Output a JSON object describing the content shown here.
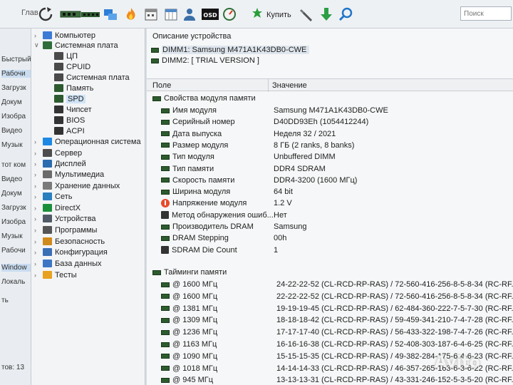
{
  "toolbar": {
    "partial_left_label": "Глав",
    "buy_label": "Купить",
    "search_placeholder": "Поиск",
    "icons": [
      "refresh-icon",
      "memory-module-icon",
      "ram-stick-icon",
      "network-icon",
      "flame-icon",
      "calendar-icon",
      "user-icon",
      "osd-icon",
      "gauge-icon",
      "buy-icon",
      "tools-icon",
      "download-arrow-icon",
      "search-icon"
    ],
    "osd_text": "OSD"
  },
  "background_window": {
    "items": [
      {
        "label": "Быстрый"
      },
      {
        "label": "Рабочи",
        "selected": true
      },
      {
        "label": "Загрузк"
      },
      {
        "label": "Докум"
      },
      {
        "label": "Изобра"
      },
      {
        "label": "Видео"
      },
      {
        "label": "Музык"
      },
      {
        "label": "тот ком"
      },
      {
        "label": "Видео"
      },
      {
        "label": "Докум"
      },
      {
        "label": "Загрузк"
      },
      {
        "label": "Изобра"
      },
      {
        "label": "Музык"
      },
      {
        "label": "Рабочи"
      },
      {
        "label": "Window",
        "selected": true
      },
      {
        "label": "Локаль"
      },
      {
        "label": "ть"
      },
      {
        "label": "тов: 13"
      }
    ]
  },
  "tree": {
    "items": [
      {
        "label": "Компьютер",
        "icon": "computer-icon",
        "color": "#3b7bd6",
        "expandable": true,
        "depth": 0
      },
      {
        "label": "Системная плата",
        "icon": "motherboard-icon",
        "color": "#2f6e3a",
        "expanded": true,
        "depth": 0
      },
      {
        "label": "ЦП",
        "icon": "cpu-icon",
        "color": "#4a4a4a",
        "depth": 1
      },
      {
        "label": "CPUID",
        "icon": "cpuid-icon",
        "color": "#4a4a4a",
        "depth": 1
      },
      {
        "label": "Системная плата",
        "icon": "board-icon",
        "color": "#4a4a4a",
        "depth": 1
      },
      {
        "label": "Память",
        "icon": "memory-icon",
        "color": "#2d5b2f",
        "depth": 1
      },
      {
        "label": "SPD",
        "icon": "spd-icon",
        "color": "#2d5b2f",
        "depth": 1,
        "selected": true
      },
      {
        "label": "Чипсет",
        "icon": "chipset-icon",
        "color": "#333333",
        "depth": 1
      },
      {
        "label": "BIOS",
        "icon": "bios-icon",
        "color": "#333333",
        "depth": 1
      },
      {
        "label": "ACPI",
        "icon": "acpi-icon",
        "color": "#333333",
        "depth": 1
      },
      {
        "label": "Операционная система",
        "icon": "windows-icon",
        "color": "#1e88e5",
        "expandable": true,
        "depth": 0
      },
      {
        "label": "Сервер",
        "icon": "server-icon",
        "color": "#4d4d4d",
        "expandable": true,
        "depth": 0
      },
      {
        "label": "Дисплей",
        "icon": "display-icon",
        "color": "#2b6cb0",
        "expandable": true,
        "depth": 0
      },
      {
        "label": "Мультимедиа",
        "icon": "multimedia-icon",
        "color": "#6b6b6b",
        "expandable": true,
        "depth": 0
      },
      {
        "label": "Хранение данных",
        "icon": "storage-icon",
        "color": "#7a7a7a",
        "expandable": true,
        "depth": 0
      },
      {
        "label": "Сеть",
        "icon": "network-icon",
        "color": "#2a7fbf",
        "expandable": true,
        "depth": 0
      },
      {
        "label": "DirectX",
        "icon": "directx-icon",
        "color": "#1a8f3a",
        "expandable": true,
        "depth": 0
      },
      {
        "label": "Устройства",
        "icon": "devices-icon",
        "color": "#4f5a66",
        "expandable": true,
        "depth": 0
      },
      {
        "label": "Программы",
        "icon": "programs-icon",
        "color": "#555555",
        "expandable": true,
        "depth": 0
      },
      {
        "label": "Безопасность",
        "icon": "security-icon",
        "color": "#d08a1c",
        "expandable": true,
        "depth": 0
      },
      {
        "label": "Конфигурация",
        "icon": "configuration-icon",
        "color": "#3a6fb5",
        "expandable": true,
        "depth": 0
      },
      {
        "label": "База данных",
        "icon": "database-icon",
        "color": "#3d77c4",
        "expandable": true,
        "depth": 0
      },
      {
        "label": "Тесты",
        "icon": "tests-icon",
        "color": "#e8a21f",
        "expandable": true,
        "depth": 0
      }
    ]
  },
  "panel": {
    "description_title": "Описание устройства",
    "devices": [
      {
        "label": "DIMM1: Samsung M471A1K43DB0-CWE",
        "selected": true
      },
      {
        "label": "DIMM2: [ TRIAL VERSION ]"
      }
    ],
    "columns": {
      "field": "Поле",
      "value": "Значение"
    },
    "properties_group": "Свойства модуля памяти",
    "properties": [
      {
        "field": "Имя модуля",
        "value": "Samsung M471A1K43DB0-CWE",
        "icon": "ram-icon"
      },
      {
        "field": "Серийный номер",
        "value": "D40DD93Eh (1054412244)",
        "icon": "ram-icon"
      },
      {
        "field": "Дата выпуска",
        "value": "Неделя 32 / 2021",
        "icon": "ram-icon"
      },
      {
        "field": "Размер модуля",
        "value": "8 ГБ (2 ranks, 8 banks)",
        "icon": "ram-icon"
      },
      {
        "field": "Тип модуля",
        "value": "Unbuffered DIMM",
        "icon": "ram-icon"
      },
      {
        "field": "Тип памяти",
        "value": "DDR4 SDRAM",
        "icon": "ram-icon"
      },
      {
        "field": "Скорость памяти",
        "value": "DDR4-3200 (1600 МГц)",
        "icon": "ram-icon"
      },
      {
        "field": "Ширина модуля",
        "value": "64 bit",
        "icon": "ram-icon"
      },
      {
        "field": "Напряжение модуля",
        "value": "1.2 V",
        "icon": "voltage-icon"
      },
      {
        "field": "Метод обнаружения ошиб...",
        "value": "Нет",
        "icon": "chip-icon"
      },
      {
        "field": "Производитель DRAM",
        "value": "Samsung",
        "icon": "ram-icon"
      },
      {
        "field": "DRAM Stepping",
        "value": "00h",
        "icon": "ram-icon"
      },
      {
        "field": "SDRAM Die Count",
        "value": "1",
        "icon": "chip-icon"
      }
    ],
    "timings_group": "Тайминги памяти",
    "timings": [
      {
        "field": "@ 1600 МГц",
        "value": "24-22-22-52  (CL-RCD-RP-RAS) / 72-560-416-256-8-5-8-34  (RC-RF..."
      },
      {
        "field": "@ 1600 МГц",
        "value": "22-22-22-52  (CL-RCD-RP-RAS) / 72-560-416-256-8-5-8-34  (RC-RF..."
      },
      {
        "field": "@ 1381 МГц",
        "value": "19-19-19-45  (CL-RCD-RP-RAS) / 62-484-360-222-7-5-7-30  (RC-RF..."
      },
      {
        "field": "@ 1309 МГц",
        "value": "18-18-18-42  (CL-RCD-RP-RAS) / 59-459-341-210-7-4-7-28  (RC-RF..."
      },
      {
        "field": "@ 1236 МГц",
        "value": "17-17-17-40  (CL-RCD-RP-RAS) / 56-433-322-198-7-4-7-26  (RC-RF..."
      },
      {
        "field": "@ 1163 МГц",
        "value": "16-16-16-38  (CL-RCD-RP-RAS) / 52-408-303-187-6-4-6-25  (RC-RF..."
      },
      {
        "field": "@ 1090 МГц",
        "value": "15-15-15-35  (CL-RCD-RP-RAS) / 49-382-284-175-6-4-6-23  (RC-RF..."
      },
      {
        "field": "@ 1018 МГц",
        "value": "14-14-14-33  (CL-RCD-RP-RAS) / 46-357-265-163-6-3-6-22  (RC-RF..."
      },
      {
        "field": "@ 945 МГц",
        "value": "13-13-13-31  (CL-RCD-RP-RAS) / 43-331-246-152-5-3-5-20  (RC-RF..."
      }
    ]
  },
  "watermark": "Avito"
}
